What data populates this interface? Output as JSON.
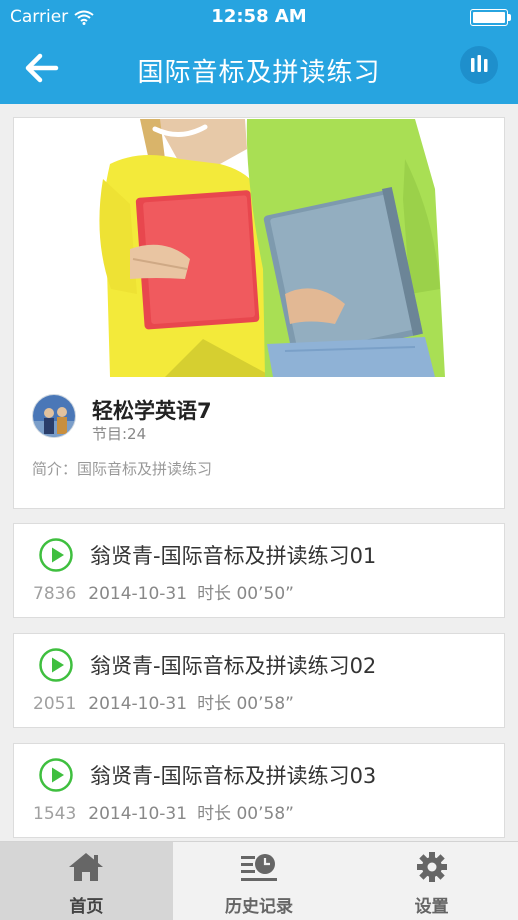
{
  "status_bar": {
    "carrier": "Carrier",
    "time": "12:58 AM"
  },
  "nav": {
    "title": "国际音标及拼读练习",
    "back_icon": "arrow-left-icon",
    "stats_icon": "equalizer-icon"
  },
  "album": {
    "name": "轻松学英语7",
    "episodes": "节目:24",
    "intro": "简介：国际音标及拼读练习"
  },
  "episodes": [
    {
      "title": "翁贤青-国际音标及拼读练习01",
      "plays": "7836",
      "date": "2014-10-31",
      "duration": "时长 00’50”"
    },
    {
      "title": "翁贤青-国际音标及拼读练习02",
      "plays": "2051",
      "date": "2014-10-31",
      "duration": "时长 00’58”"
    },
    {
      "title": "翁贤青-国际音标及拼读练习03",
      "plays": "1543",
      "date": "2014-10-31",
      "duration": "时长 00’58”"
    }
  ],
  "tabs": [
    {
      "label": "首页",
      "icon": "home-icon",
      "active": true
    },
    {
      "label": "历史记录",
      "icon": "history-icon",
      "active": false
    },
    {
      "label": "设置",
      "icon": "gear-icon",
      "active": false
    }
  ],
  "colors": {
    "primary": "#27a4e0",
    "play_green": "#3fbf3f"
  }
}
